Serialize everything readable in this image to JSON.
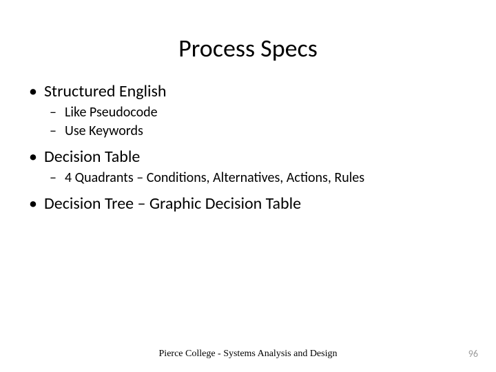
{
  "title": "Process Specs",
  "bullets": [
    {
      "text": "Structured English",
      "subs": [
        "Like Pseudocode",
        "Use Keywords"
      ]
    },
    {
      "text": "Decision Table",
      "subs": [
        "4 Quadrants – Conditions, Alternatives, Actions, Rules"
      ]
    },
    {
      "text": "Decision Tree – Graphic Decision Table",
      "subs": []
    }
  ],
  "footer": "Pierce College - Systems Analysis and Design",
  "page_number": "96"
}
